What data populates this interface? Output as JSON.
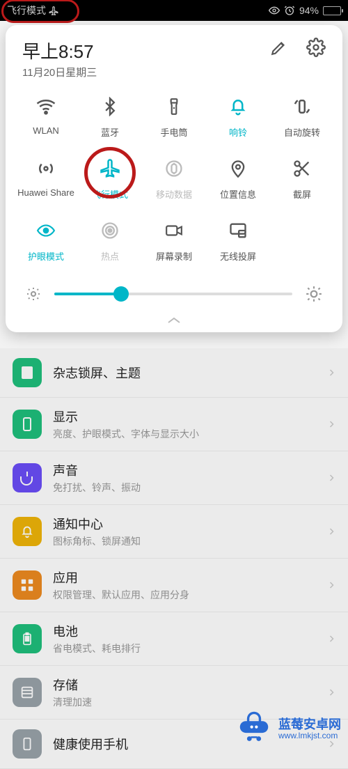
{
  "status_bar": {
    "airplane_label": "飞行模式",
    "battery_pct": "94%"
  },
  "panel": {
    "time": "早上8:57",
    "date": "11月20日星期三",
    "qs": [
      {
        "label": "WLAN",
        "state": "normal"
      },
      {
        "label": "蓝牙",
        "state": "normal"
      },
      {
        "label": "手电筒",
        "state": "normal"
      },
      {
        "label": "响铃",
        "state": "active"
      },
      {
        "label": "自动旋转",
        "state": "normal"
      },
      {
        "label": "Huawei Share",
        "state": "normal"
      },
      {
        "label": "飞行模式",
        "state": "active"
      },
      {
        "label": "移动数据",
        "state": "disabled"
      },
      {
        "label": "位置信息",
        "state": "normal"
      },
      {
        "label": "截屏",
        "state": "normal"
      },
      {
        "label": "护眼模式",
        "state": "active"
      },
      {
        "label": "热点",
        "state": "disabled"
      },
      {
        "label": "屏幕录制",
        "state": "normal"
      },
      {
        "label": "无线投屏",
        "state": "normal"
      }
    ]
  },
  "settings": [
    {
      "title": "杂志锁屏、主题",
      "sub": "",
      "color": "#19c27b"
    },
    {
      "title": "显示",
      "sub": "亮度、护眼模式、字体与显示大小",
      "color": "#19c27b"
    },
    {
      "title": "声音",
      "sub": "免打扰、铃声、振动",
      "color": "#6b4dff"
    },
    {
      "title": "通知中心",
      "sub": "图标角标、锁屏通知",
      "color": "#f2b400"
    },
    {
      "title": "应用",
      "sub": "权限管理、默认应用、应用分身",
      "color": "#f28a1a"
    },
    {
      "title": "电池",
      "sub": "省电模式、耗电排行",
      "color": "#19c27b"
    },
    {
      "title": "存储",
      "sub": "清理加速",
      "color": "#9aa3ab"
    },
    {
      "title": "健康使用手机",
      "sub": "",
      "color": "#9aa3ab"
    }
  ],
  "watermark": {
    "name": "蓝莓安卓网",
    "url": "www.lmkjst.com"
  },
  "colors": {
    "accent": "#00b6c8",
    "annotation": "#bb1a1a"
  }
}
